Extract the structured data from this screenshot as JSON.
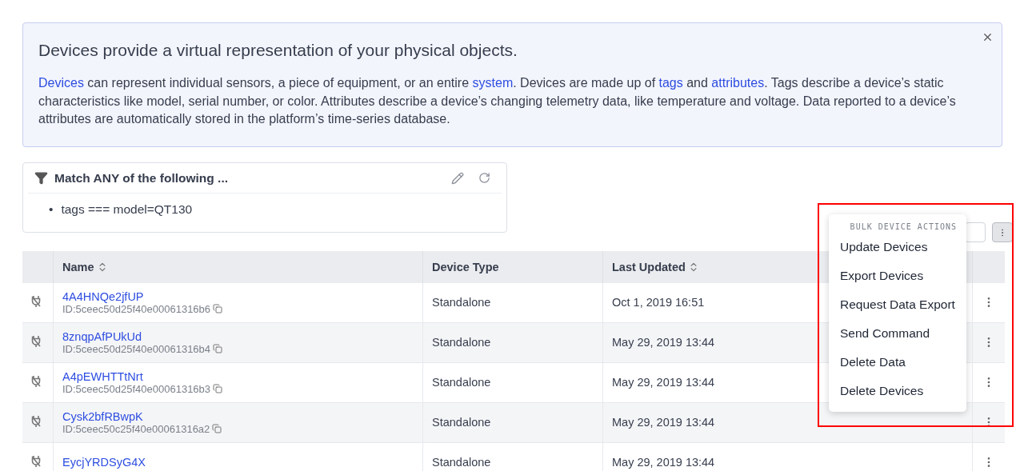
{
  "banner": {
    "title": "Devices provide a virtual representation of your physical objects.",
    "paragraph": [
      {
        "text": "Devices",
        "link": true
      },
      {
        "text": " can represent individual sensors, a piece of equipment, or an entire ",
        "link": false
      },
      {
        "text": "system",
        "link": true
      },
      {
        "text": ". Devices are made up of ",
        "link": false
      },
      {
        "text": "tags",
        "link": true
      },
      {
        "text": " and ",
        "link": false
      },
      {
        "text": "attributes",
        "link": true
      },
      {
        "text": ". Tags describe a device’s static characteristics like model, serial number, or color. Attributes describe a device’s changing telemetry data, like temperature and voltage. Data reported to a device’s attributes are automatically stored in the platform’s time-series database.",
        "link": false
      }
    ]
  },
  "filter": {
    "title": "Match ANY of the following ...",
    "conditions": [
      {
        "bullet": "•",
        "text": "tags === model=QT130"
      }
    ]
  },
  "table": {
    "columns": [
      {
        "label": "Name",
        "sortable": true
      },
      {
        "label": "Device Type",
        "sortable": false
      },
      {
        "label": "Last Updated",
        "sortable": true
      }
    ],
    "rows": [
      {
        "name": "4A4HNQe2jfUP",
        "id": "ID:5ceec50d25f40e00061316b6",
        "type": "Standalone",
        "updated": "Oct 1, 2019 16:51"
      },
      {
        "name": "8znqpAfPUkUd",
        "id": "ID:5ceec50d25f40e00061316b4",
        "type": "Standalone",
        "updated": "May 29, 2019 13:44"
      },
      {
        "name": "A4pEWHTTtNrt",
        "id": "ID:5ceec50d25f40e00061316b3",
        "type": "Standalone",
        "updated": "May 29, 2019 13:44"
      },
      {
        "name": "Cysk2bfRBwpK",
        "id": "ID:5ceec50c25f40e00061316a2",
        "type": "Standalone",
        "updated": "May 29, 2019 13:44"
      },
      {
        "name": "EycjYRDSyG4X",
        "type": "Standalone",
        "updated": "May 29, 2019 13:44"
      }
    ]
  },
  "bulk_menu": {
    "heading": "BULK DEVICE ACTIONS",
    "items": [
      "Update Devices",
      "Export Devices",
      "Request Data Export",
      "Send Command",
      "Delete Data",
      "Delete Devices"
    ]
  }
}
